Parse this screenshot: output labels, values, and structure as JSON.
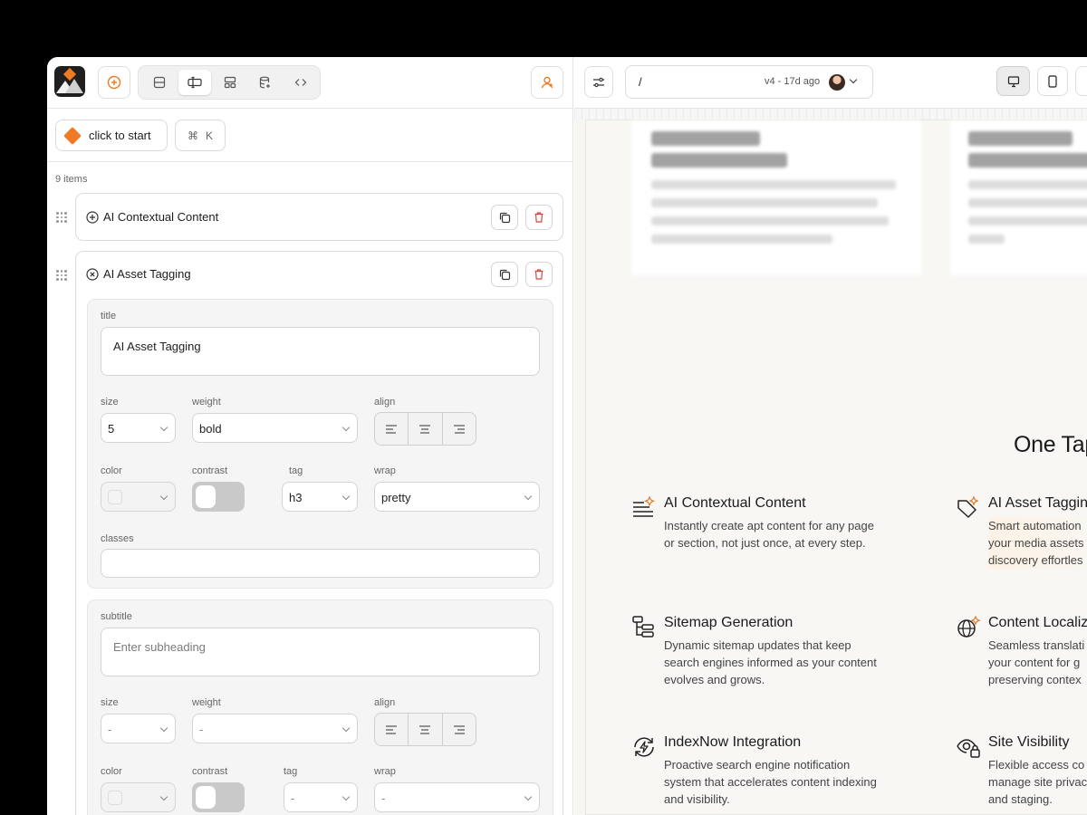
{
  "toolbar": {
    "start_label": "click to start",
    "shortcut_symbol": "⌘",
    "shortcut_key": "K"
  },
  "list": {
    "count_label": "9 items"
  },
  "items": [
    {
      "title": "AI Contextual Content",
      "expanded": false
    },
    {
      "title": "AI Asset Tagging",
      "expanded": true
    }
  ],
  "editor": {
    "title_section": {
      "label": "title",
      "value": "AI Asset Tagging",
      "size_label": "size",
      "size_value": "5",
      "weight_label": "weight",
      "weight_value": "bold",
      "align_label": "align",
      "color_label": "color",
      "contrast_label": "contrast",
      "tag_label": "tag",
      "tag_value": "h3",
      "wrap_label": "wrap",
      "wrap_value": "pretty",
      "classes_label": "classes",
      "classes_value": ""
    },
    "subtitle_section": {
      "label": "subtitle",
      "placeholder": "Enter subheading",
      "size_label": "size",
      "size_value": "-",
      "weight_label": "weight",
      "weight_value": "-",
      "align_label": "align",
      "color_label": "color",
      "contrast_label": "contrast",
      "tag_label": "tag",
      "tag_value": "-",
      "wrap_label": "wrap",
      "wrap_value": "-"
    }
  },
  "browser": {
    "path": "/",
    "version": "v4 - 17d ago"
  },
  "preview": {
    "blurred_cards": [
      {
        "title_line1": "From idea to",
        "title_line2": "page in seconds"
      },
      {
        "title_line1": "From local to",
        "title_line2": "global in a click"
      }
    ],
    "heading": "One Tap",
    "features": [
      {
        "title": "AI Contextual Content",
        "desc": "Instantly create apt content for any page\nor section, not just once, at every step.",
        "icon": "lines-sparkle-icon"
      },
      {
        "title": "AI Asset Taggin",
        "desc": "Smart automation\nyour media assets\ndiscovery effortles",
        "icon": "tag-sparkle-icon"
      },
      {
        "title": "Sitemap Generation",
        "desc": "Dynamic sitemap updates that keep\nsearch engines informed as your content\nevolves and grows.",
        "icon": "sitemap-icon"
      },
      {
        "title": "Content Localiz",
        "desc": "Seamless translati\nyour content for g\npreserving contex",
        "icon": "globe-sparkle-icon"
      },
      {
        "title": "IndexNow Integration",
        "desc": "Proactive search engine notification\nsystem that accelerates content indexing\nand visibility.",
        "icon": "refresh-bolt-icon"
      },
      {
        "title": "Site Visibility",
        "desc": "Flexible access co\nmanage site privac\nand staging.",
        "icon": "eye-lock-icon"
      }
    ]
  },
  "colors": {
    "accent": "#ef7a22",
    "danger": "#d9443a"
  }
}
